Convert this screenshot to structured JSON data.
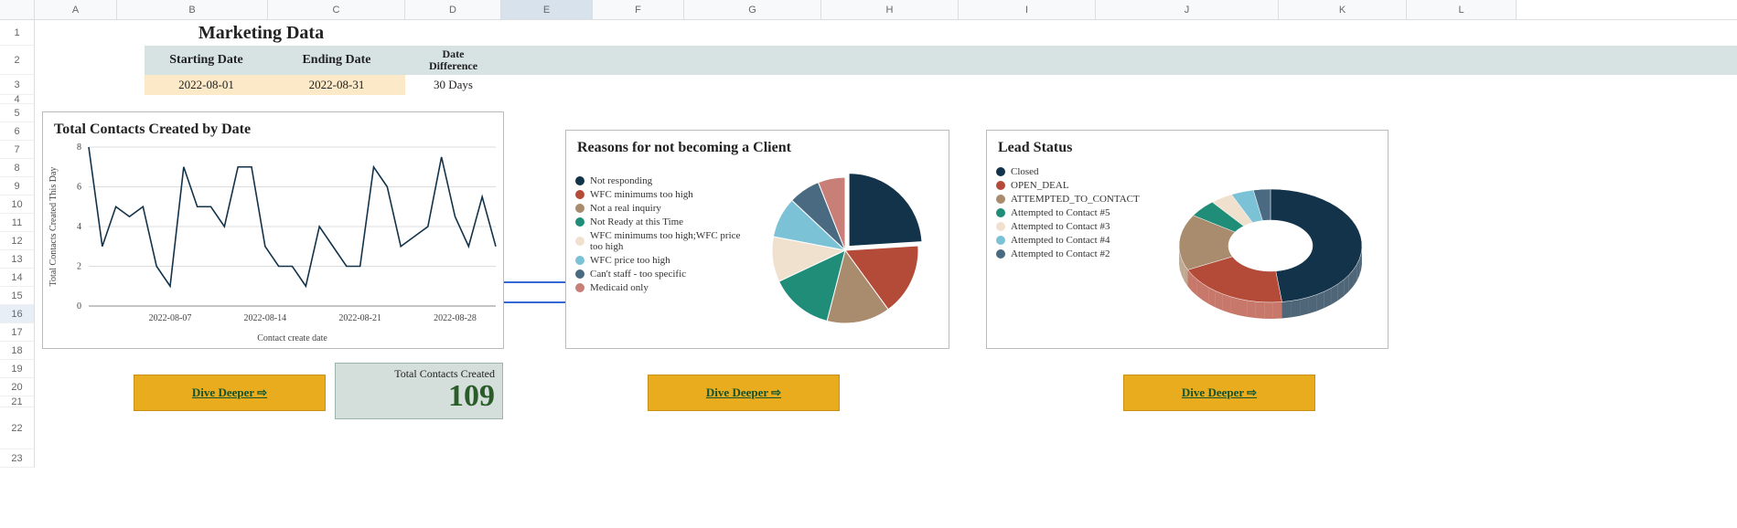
{
  "columns": [
    "A",
    "B",
    "C",
    "D",
    "E",
    "F",
    "G",
    "H",
    "I",
    "J",
    "K",
    "L"
  ],
  "rows": [
    "1",
    "2",
    "3",
    "4",
    "5",
    "6",
    "7",
    "8",
    "9",
    "10",
    "11",
    "12",
    "13",
    "14",
    "15",
    "16",
    "17",
    "18",
    "19",
    "20",
    "21",
    "22",
    "23"
  ],
  "title": "Marketing Data",
  "headers": {
    "start": "Starting Date",
    "end": "Ending Date",
    "diff1": "Date",
    "diff2": "Difference"
  },
  "values": {
    "start": "2022-08-01",
    "end": "2022-08-31",
    "diff": "30 Days"
  },
  "chart_data": [
    {
      "type": "line",
      "title": "Total Contacts Created by Date",
      "xlabel": "Contact create date",
      "ylabel": "Total Contacts Created This Day",
      "ylim": [
        0,
        8
      ],
      "x_ticks": [
        "2022-08-07",
        "2022-08-14",
        "2022-08-21",
        "2022-08-28"
      ],
      "y_ticks": [
        0,
        2,
        4,
        6,
        8
      ],
      "values": [
        8,
        3,
        5,
        4.5,
        5,
        2,
        1,
        7,
        5,
        5,
        4,
        7,
        7,
        3,
        2,
        2,
        1,
        4,
        3,
        2,
        2,
        7,
        6,
        3,
        3.5,
        4,
        7.5,
        4.5,
        3,
        5.5,
        3
      ]
    },
    {
      "type": "pie",
      "title": "Reasons for not becoming a Client",
      "series": [
        {
          "name": "Not responding",
          "value": 24,
          "color": "#13334a"
        },
        {
          "name": "WFC minimums too high",
          "value": 16,
          "color": "#b44b39"
        },
        {
          "name": "Not a real inquiry",
          "value": 14,
          "color": "#a98b6e"
        },
        {
          "name": "Not Ready at this Time",
          "value": 14,
          "color": "#1f8d78"
        },
        {
          "name": "WFC minimums too high;WFC price too high",
          "value": 10,
          "color": "#f0e1cf"
        },
        {
          "name": "WFC price too high",
          "value": 9,
          "color": "#7cc2d6"
        },
        {
          "name": "Can't staff - too specific",
          "value": 7,
          "color": "#4a6a82"
        },
        {
          "name": "Medicaid only",
          "value": 6,
          "color": "#c77f77"
        }
      ]
    },
    {
      "type": "pie",
      "title": "Lead Status",
      "donut": true,
      "series": [
        {
          "name": "Closed",
          "value": 48,
          "color": "#13334a"
        },
        {
          "name": "OPEN_DEAL",
          "value": 20,
          "color": "#b44b39"
        },
        {
          "name": "ATTEMPTED_TO_CONTACT",
          "value": 16,
          "color": "#a98b6e"
        },
        {
          "name": "Attempted to Contact #5",
          "value": 5,
          "color": "#1f8d78"
        },
        {
          "name": "Attempted to Contact #3",
          "value": 4,
          "color": "#f0e1cf"
        },
        {
          "name": "Attempted to Contact #4",
          "value": 4,
          "color": "#7cc2d6"
        },
        {
          "name": "Attempted to Contact #2",
          "value": 3,
          "color": "#4a6a82"
        }
      ]
    }
  ],
  "dive_label": "Dive Deeper ⇨",
  "kpi": {
    "label": "Total Contacts Created",
    "value": "109"
  }
}
